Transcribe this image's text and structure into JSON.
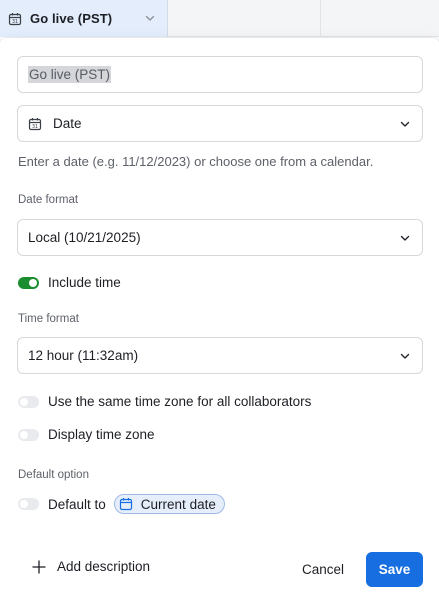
{
  "header": {
    "column_title": "Go live (PST)",
    "icon": "calendar-icon"
  },
  "field_name": {
    "value": "Go live (PST)"
  },
  "field_type": {
    "selected": "Date",
    "icon": "calendar-icon"
  },
  "hint": "Enter a date (e.g. 11/12/2023) or choose one from a calendar.",
  "date_format": {
    "label": "Date format",
    "selected": "Local (10/21/2025)"
  },
  "include_time": {
    "label": "Include time",
    "on": true
  },
  "time_format": {
    "label": "Time format",
    "selected": "12 hour (11:32am)"
  },
  "same_timezone": {
    "label": "Use the same time zone for all collaborators",
    "on": false
  },
  "display_timezone": {
    "label": "Display time zone",
    "on": false
  },
  "default_option": {
    "label": "Default option",
    "toggle_label": "Default to",
    "chip_label": "Current date",
    "on": false
  },
  "footer": {
    "add_description": "Add description",
    "cancel": "Cancel",
    "save": "Save"
  },
  "colors": {
    "accent": "#166ee1",
    "toggle_on": "#1a8e2f",
    "header_active": "#e3edfb"
  }
}
